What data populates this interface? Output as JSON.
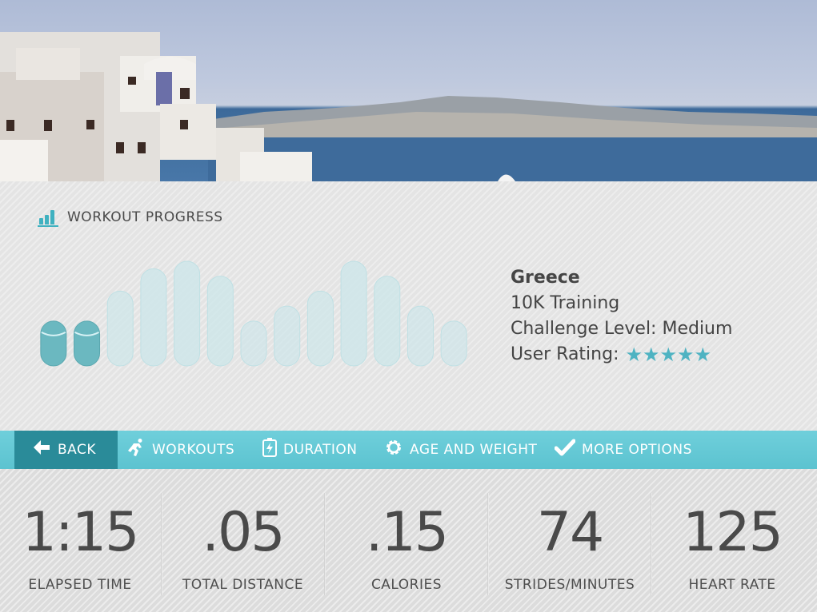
{
  "section": {
    "title": "WORKOUT PROGRESS",
    "icon": "bar-chart-icon"
  },
  "workout": {
    "place": "Greece",
    "program": "10K Training",
    "challenge": "Challenge Level: Medium",
    "rating_label": "User Rating:",
    "rating_stars": 5
  },
  "chart_data": {
    "type": "bar",
    "values": [
      3,
      3,
      5,
      6.5,
      7,
      6,
      3,
      4,
      5,
      7,
      6,
      4,
      3
    ],
    "completed_segments": 2,
    "colors": {
      "completed": "#6bb8c0",
      "upcoming": "#cfe6e9",
      "accent": "#9fd4dc"
    }
  },
  "nav": {
    "back": "BACK",
    "workouts": "WORKOUTS",
    "duration": "DURATION",
    "age_weight": "AGE AND WEIGHT",
    "more": "MORE OPTIONS"
  },
  "stats": [
    {
      "value": "1:15",
      "label": "ELAPSED TIME"
    },
    {
      "value": ".05",
      "label": "TOTAL DISTANCE"
    },
    {
      "value": ".15",
      "label": "CALORIES"
    },
    {
      "value": "74",
      "label": "STRIDES/MINUTES"
    },
    {
      "value": "125",
      "label": "HEART RATE"
    }
  ],
  "colors": {
    "accent": "#5cc3d0",
    "back_bg": "#2a8b99",
    "star": "#4fb3c2"
  }
}
